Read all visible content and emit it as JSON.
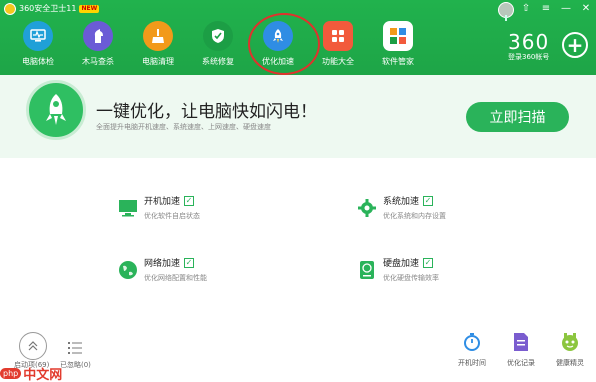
{
  "window": {
    "title": "360安全卫士11",
    "badge": "NEW",
    "controls": [
      "⇧",
      "≡",
      "—",
      "✕"
    ]
  },
  "nav": {
    "items": [
      {
        "label": "电脑体检",
        "icon": "monitor-check-icon",
        "color": "#20a0d8"
      },
      {
        "label": "木马查杀",
        "icon": "horse-icon",
        "color": "#6b5bd6"
      },
      {
        "label": "电脑清理",
        "icon": "broom-icon",
        "color": "#f29a1a"
      },
      {
        "label": "系统修复",
        "icon": "shield-icon",
        "color": "#1c9e45"
      },
      {
        "label": "优化加速",
        "icon": "rocket-icon",
        "color": "#2f8de4"
      },
      {
        "label": "功能大全",
        "icon": "grid-icon",
        "color": "#f25a3c"
      },
      {
        "label": "软件管家",
        "icon": "app-store-icon",
        "color": "#1fa39a"
      }
    ],
    "active_index": 4
  },
  "account": {
    "brand": "360",
    "login_text": "登录360帐号"
  },
  "hero": {
    "title": "一键优化，让电脑快如闪电！",
    "subtitle": "全面提升电脑开机速度、系统速度、上网速度、硬盘速度",
    "scan_button": "立即扫描"
  },
  "features": [
    {
      "title": "开机加速",
      "desc": "优化软件自启状态",
      "icon": "monitor-icon",
      "checked": true
    },
    {
      "title": "系统加速",
      "desc": "优化系统和内存设置",
      "icon": "gear-icon",
      "checked": true
    },
    {
      "title": "网络加速",
      "desc": "优化网络配置和性能",
      "icon": "globe-icon",
      "checked": true
    },
    {
      "title": "硬盘加速",
      "desc": "优化硬盘传输效率",
      "icon": "hard-disk-icon",
      "checked": true
    }
  ],
  "bottom": {
    "startup_label": "启动项(69)",
    "optimized_label": "已忽略(0)",
    "tools": [
      {
        "label": "开机时间",
        "icon": "stopwatch-icon"
      },
      {
        "label": "优化记录",
        "icon": "document-icon"
      },
      {
        "label": "健康精灵",
        "icon": "mascot-icon"
      }
    ]
  },
  "watermark": {
    "php": "php",
    "cn": "中文网"
  },
  "colors": {
    "header_green": "#1ea547",
    "accent_green": "#2ab35a",
    "annotation_red": "#e0322d"
  }
}
